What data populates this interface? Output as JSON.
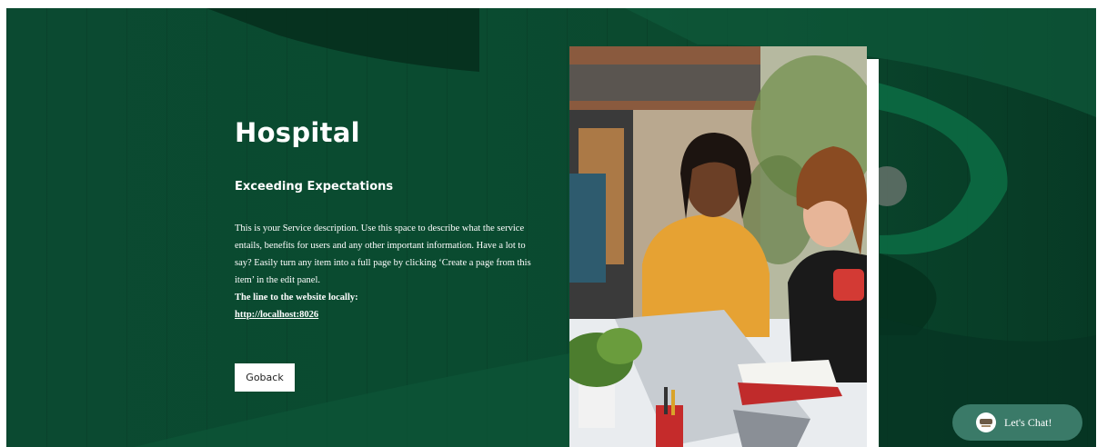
{
  "service": {
    "title": "Hospital",
    "subtitle": "Exceeding Expectations",
    "description": "This is your Service description. Use this space to describe what the service entails, benefits for users and any other important information. Have a lot to say? Easily turn any item into a full page by clicking ‘Create a page from this item’ in the edit panel.",
    "link_label": "The line to the website locally:",
    "link_url": "http://localhost:8026",
    "back_button": "Goback"
  },
  "chat": {
    "label": "Let's Chat!"
  },
  "colors": {
    "background": "#0b4a31",
    "chat_button": "#3a7a68",
    "text": "#ffffff"
  },
  "icons": {
    "chat": "chat-logo-icon"
  }
}
